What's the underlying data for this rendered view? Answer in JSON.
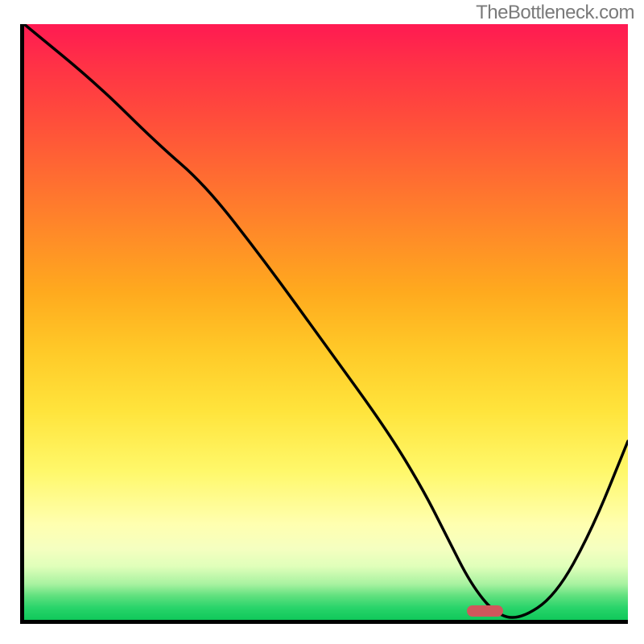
{
  "watermark": "TheBottleneck.com",
  "chart_data": {
    "type": "line",
    "title": "",
    "xlabel": "",
    "ylabel": "",
    "xlim": [
      0,
      100
    ],
    "ylim": [
      0,
      100
    ],
    "grid": false,
    "legend": false,
    "background": {
      "type": "vertical-gradient",
      "description": "red (top) → orange → yellow → green (bottom)",
      "stops": [
        {
          "pos": 0,
          "color": "#ff1a52"
        },
        {
          "pos": 50,
          "color": "#ffca28"
        },
        {
          "pos": 85,
          "color": "#ffffb0"
        },
        {
          "pos": 100,
          "color": "#10c85a"
        }
      ]
    },
    "series": [
      {
        "name": "bottleneck-curve",
        "x": [
          0,
          12,
          22,
          30,
          40,
          50,
          60,
          66,
          70,
          74,
          78,
          82,
          88,
          94,
          100
        ],
        "values": [
          100,
          90,
          80,
          73,
          60,
          46,
          32,
          22,
          14,
          6,
          1,
          0,
          4,
          15,
          30
        ]
      }
    ],
    "annotations": [
      {
        "name": "optimal-marker",
        "shape": "rounded-rect",
        "color": "#d0575c",
        "x": 77,
        "y": 1.5,
        "width_pct": 6,
        "height_pct": 2
      }
    ]
  }
}
